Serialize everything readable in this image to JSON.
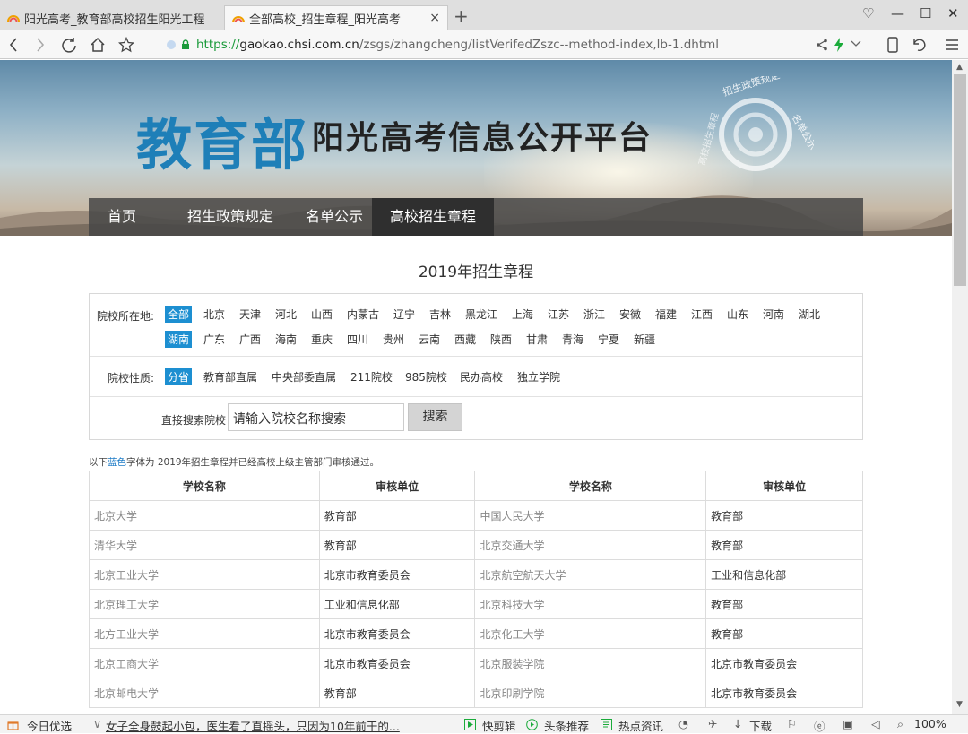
{
  "browser": {
    "tabs": [
      {
        "title": "阳光高考_教育部高校招生阳光工程"
      },
      {
        "title": "全部高校_招生章程_阳光高考",
        "close": "×"
      }
    ],
    "new_tab": "+",
    "window_controls": {
      "skin": "♡",
      "minimize": "—",
      "maximize": "☐",
      "close": "✕"
    },
    "url": {
      "scheme": "https://",
      "domain": "gaokao.chsi.com.cn",
      "path": "/zsgs/zhangcheng/listVerifedZszc--method-index,lb-1.dhtml"
    }
  },
  "site": {
    "logo_main": "教育部",
    "logo_sub": "阳光高考信息公开平台",
    "seal_text_top": "招生政策规定",
    "seal_text_right": "名单公示",
    "seal_text_left": "高校招生章程",
    "nav": [
      {
        "label": "首页",
        "active": false
      },
      {
        "label": "招生政策规定",
        "active": false
      },
      {
        "label": "名单公示",
        "active": false
      },
      {
        "label": "高校招生章程",
        "active": true
      }
    ]
  },
  "page": {
    "title": "2019年招生章程",
    "filters": {
      "location_label": "院校所在地:",
      "locations_row1": [
        "全部",
        "北京",
        "天津",
        "河北",
        "山西",
        "内蒙古",
        "辽宁",
        "吉林",
        "黑龙江",
        "上海",
        "江苏",
        "浙江",
        "安徽",
        "福建",
        "江西",
        "山东",
        "河南",
        "湖北"
      ],
      "locations_row2": [
        "湖南",
        "广东",
        "广西",
        "海南",
        "重庆",
        "四川",
        "贵州",
        "云南",
        "西藏",
        "陕西",
        "甘肃",
        "青海",
        "宁夏",
        "新疆"
      ],
      "nature_label": "院校性质:",
      "natures": [
        "分省",
        "教育部直属",
        "中央部委直属",
        "211院校",
        "985院校",
        "民办高校",
        "独立学院"
      ],
      "search_label": "直接搜索院校",
      "search_placeholder": "请输入院校名称搜索",
      "search_button": "搜索"
    },
    "note_prefix": "以下",
    "note_blue": "蓝色",
    "note_suffix": "字体为 2019年招生章程并已经高校上级主管部门审核通过。",
    "table": {
      "headers": [
        "学校名称",
        "审核单位",
        "学校名称",
        "审核单位"
      ],
      "rows": [
        [
          "北京大学",
          "教育部",
          "中国人民大学",
          "教育部"
        ],
        [
          "清华大学",
          "教育部",
          "北京交通大学",
          "教育部"
        ],
        [
          "北京工业大学",
          "北京市教育委员会",
          "北京航空航天大学",
          "工业和信息化部"
        ],
        [
          "北京理工大学",
          "工业和信息化部",
          "北京科技大学",
          "教育部"
        ],
        [
          "北方工业大学",
          "北京市教育委员会",
          "北京化工大学",
          "教育部"
        ],
        [
          "北京工商大学",
          "北京市教育委员会",
          "北京服装学院",
          "北京市教育委员会"
        ],
        [
          "北京邮电大学",
          "教育部",
          "北京印刷学院",
          "北京市教育委员会"
        ]
      ]
    }
  },
  "statusbar": {
    "today": "今日优选",
    "news": "女子全身鼓起小包，医生看了直摇头，只因为10年前干的...",
    "items": [
      "快剪辑",
      "头条推荐",
      "热点资讯",
      "下载"
    ],
    "zoom": "100%"
  },
  "colors": {
    "accent": "#1d8fd1",
    "logo_blue": "#1e7fb8",
    "nav_bg": "#464646"
  }
}
